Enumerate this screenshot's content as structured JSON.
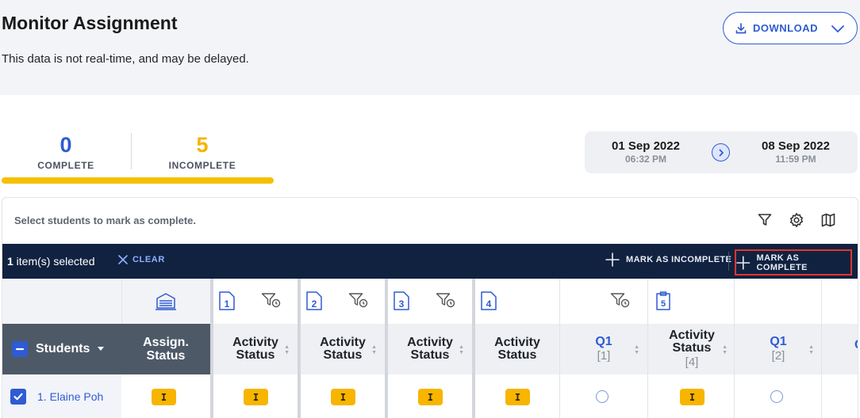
{
  "header": {
    "title": "Monitor Assignment",
    "subtitle": "This data is not real-time, and may be delayed.",
    "download_label": "DOWNLOAD"
  },
  "summary": {
    "complete_count": "0",
    "complete_label": "COMPLETE",
    "incomplete_count": "5",
    "incomplete_label": "INCOMPLETE"
  },
  "date_range": {
    "start_date": "01 Sep 2022",
    "start_time": "06:32 PM",
    "end_date": "08 Sep 2022",
    "end_time": "11:59 PM"
  },
  "panel": {
    "hint": "Select students to mark as complete.",
    "tools": [
      "filter-icon",
      "settings-icon",
      "map-icon"
    ]
  },
  "action_bar": {
    "selected_count": "1",
    "selected_suffix": " item(s) selected",
    "clear_label": "CLEAR",
    "mark_incomplete_label": "MARK AS INCOMPLETE",
    "mark_complete_label": "MARK AS COMPLETE"
  },
  "table": {
    "activity_numbers": [
      "1",
      "2",
      "3",
      "4",
      "5"
    ],
    "students_header": "Students",
    "assign_header_line1": "Assign.",
    "assign_header_line2": "Status",
    "columns": [
      {
        "line1": "Activity",
        "line2": "Status"
      },
      {
        "line1": "Activity",
        "line2": "Status"
      },
      {
        "line1": "Activity",
        "line2": "Status"
      },
      {
        "line1": "Activity",
        "line2": "Status"
      },
      {
        "line1": "Q1",
        "line2": "[1]"
      },
      {
        "line1": "Activity",
        "line2": "Status",
        "line3": "[4]"
      },
      {
        "line1": "Q1",
        "line2": "[2]"
      }
    ],
    "rows": [
      {
        "name": "1. Elaine Poh",
        "assign_status": "I",
        "statuses": [
          "I",
          "I",
          "I",
          "I",
          "",
          "I",
          ""
        ]
      }
    ]
  },
  "colors": {
    "brand_blue": "#2f5bd3",
    "incomplete_yellow": "#f5b400",
    "action_bar_navy": "#112240",
    "highlight_red": "#e2362b"
  }
}
